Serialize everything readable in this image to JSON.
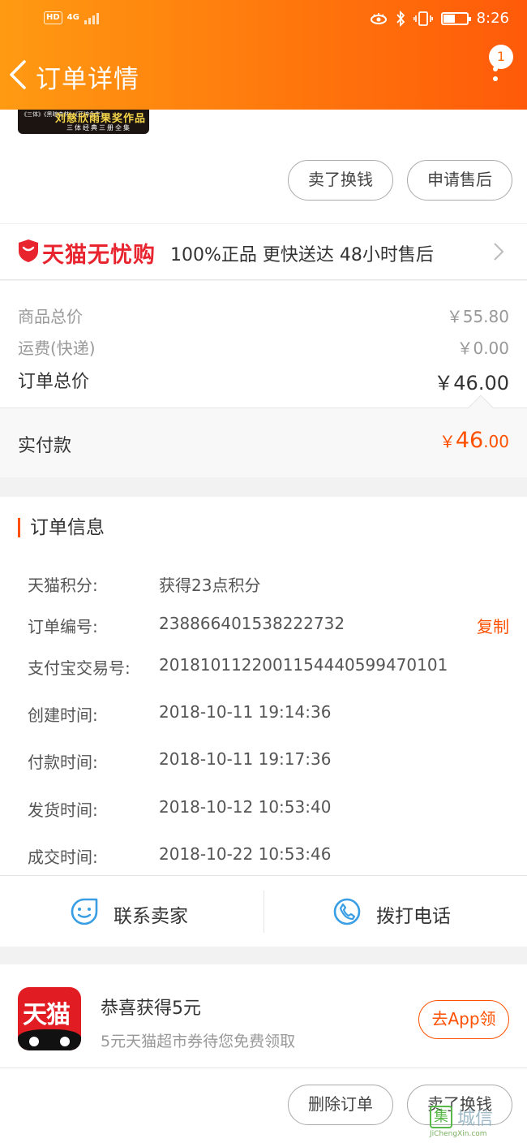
{
  "status_bar": {
    "network": "4G",
    "hd": "HD",
    "time": "8:26"
  },
  "header": {
    "title": "订单详情",
    "notification_count": "1"
  },
  "product_thumb": {
    "line0": "《三体》《黑暗森林》《死神永生》",
    "line1": "刘慈欣雨果奖作品",
    "line2": "三体经典三册全集"
  },
  "order_actions_top": {
    "sell_label": "卖了换钱",
    "after_sale_label": "申请售后"
  },
  "tmall_guarantee": {
    "brand": "天猫无忧购",
    "features": "100%正品  更快送达  48小时售后"
  },
  "prices": {
    "goods_total_label": "商品总价",
    "goods_total_value": "￥55.80",
    "shipping_label": "运费(快递)",
    "shipping_value": "￥0.00",
    "order_total_label": "订单总价",
    "order_total_value": "￥46.00"
  },
  "paid": {
    "label": "实付款",
    "symbol": "￥",
    "integer": "46",
    "decimal": ".00"
  },
  "order_info": {
    "title": "订单信息",
    "rows": [
      {
        "key": "天猫积分:",
        "value": "获得23点积分"
      },
      {
        "key": "订单编号:",
        "value": "2388664015382227​32",
        "action": "复制"
      },
      {
        "key": "支付宝交易号:",
        "value": "2018101122001154440599470101"
      },
      {
        "key": "创建时间:",
        "value": "2018-10-11 19:14:36"
      },
      {
        "key": "付款时间:",
        "value": "2018-10-11 19:17:36"
      },
      {
        "key": "发货时间:",
        "value": "2018-10-12 10:53:40"
      },
      {
        "key": "成交时间:",
        "value": "2018-10-22 10:53:46"
      }
    ]
  },
  "contact": {
    "seller_label": "联系卖家",
    "phone_label": "拨打电话"
  },
  "promo": {
    "app_icon_text": "天猫",
    "title": "恭喜获得5元",
    "subtitle": "5元天猫超市券待您免费领取",
    "button": "去App领"
  },
  "order_actions_bottom": {
    "delete_label": "删除订单",
    "sell_label": "卖了换钱"
  },
  "watermark": {
    "text": "城信",
    "url": "JiChengXin.com"
  },
  "colors": {
    "accent": "#ff5000",
    "tmall_red": "#e8242f",
    "contact_icon": "#3a9ee4"
  }
}
